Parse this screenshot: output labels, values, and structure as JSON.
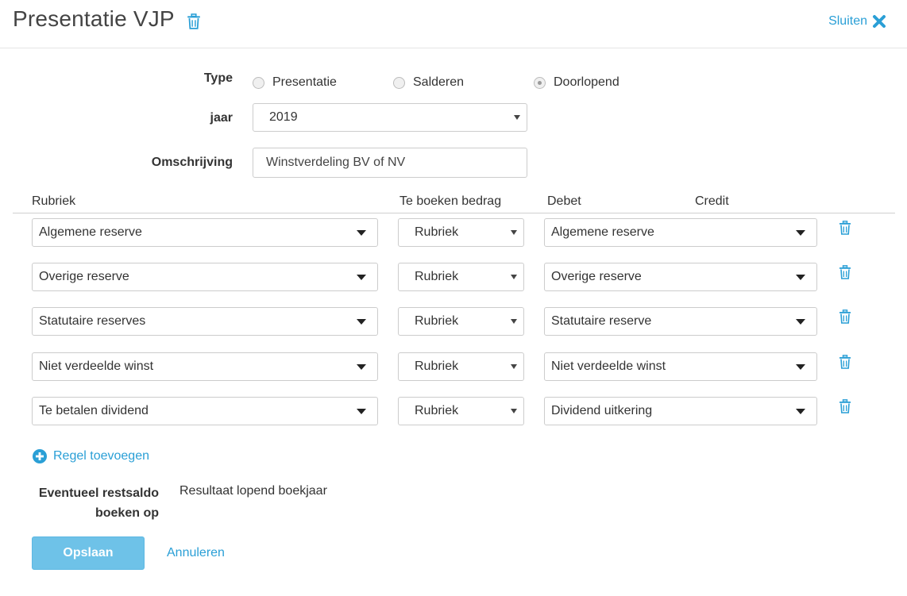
{
  "header": {
    "title": "Presentatie VJP",
    "close_label": "Sluiten",
    "delete_icon": "trash-icon",
    "close_icon": "close-x-icon"
  },
  "form": {
    "type_label": "Type",
    "type_options": [
      "Presentatie",
      "Salderen",
      "Doorlopend"
    ],
    "type_selected": "Doorlopend",
    "jaar_label": "jaar",
    "jaar_value": "2019",
    "omschrijving_label": "Omschrijving",
    "omschrijving_value": "Winstverdeling BV of NV"
  },
  "table": {
    "headers": {
      "rubriek": "Rubriek",
      "bedrag": "Te boeken bedrag",
      "debet": "Debet",
      "credit": "Credit"
    },
    "rows": [
      {
        "rubriek": "Algemene reserve",
        "bedrag": "Rubriek",
        "debet": "Algemene reserve"
      },
      {
        "rubriek": "Overige reserve",
        "bedrag": "Rubriek",
        "debet": "Overige reserve"
      },
      {
        "rubriek": "Statutaire reserves",
        "bedrag": "Rubriek",
        "debet": "Statutaire reserve"
      },
      {
        "rubriek": "Niet verdeelde winst",
        "bedrag": "Rubriek",
        "debet": "Niet verdeelde winst"
      },
      {
        "rubriek": "Te betalen dividend",
        "bedrag": "Rubriek",
        "debet": "Dividend uitkering"
      }
    ]
  },
  "add_row_label": "Regel toevoegen",
  "rest": {
    "label_line1": "Eventueel restsaldo",
    "label_line2": "boeken op",
    "value": "Resultaat lopend boekjaar"
  },
  "actions": {
    "save_label": "Opslaan",
    "cancel_label": "Annuleren"
  },
  "colors": {
    "accent": "#2a9fd6",
    "save_button": "#6ec2e8"
  }
}
